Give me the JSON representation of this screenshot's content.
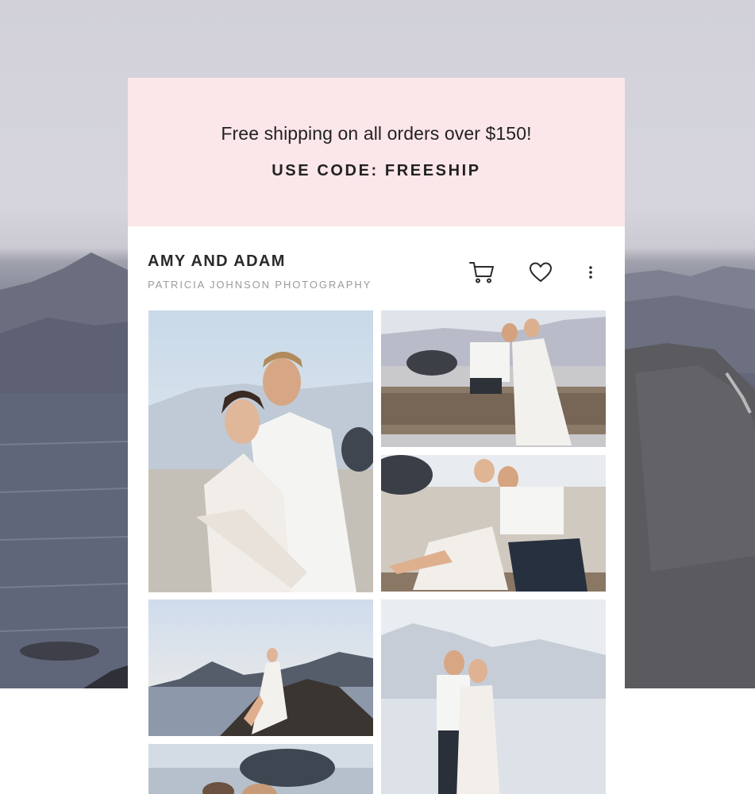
{
  "promo": {
    "line": "Free shipping on all orders over $150!",
    "code": "USE CODE: FREESHIP",
    "background": "#fbe6ea"
  },
  "gallery": {
    "title": "AMY AND ADAM",
    "photographer": "PATRICIA JOHNSON PHOTOGRAPHY"
  },
  "actions": {
    "cart_icon": "cart-icon",
    "favorite_icon": "heart-icon",
    "more_icon": "more-vertical-icon"
  },
  "photos": [
    {
      "id": "couple-embrace-portrait"
    },
    {
      "id": "couple-on-log"
    },
    {
      "id": "couple-sitting-beach"
    },
    {
      "id": "bride-on-rock"
    },
    {
      "id": "couple-standing-shore"
    },
    {
      "id": "rock-partial"
    }
  ]
}
